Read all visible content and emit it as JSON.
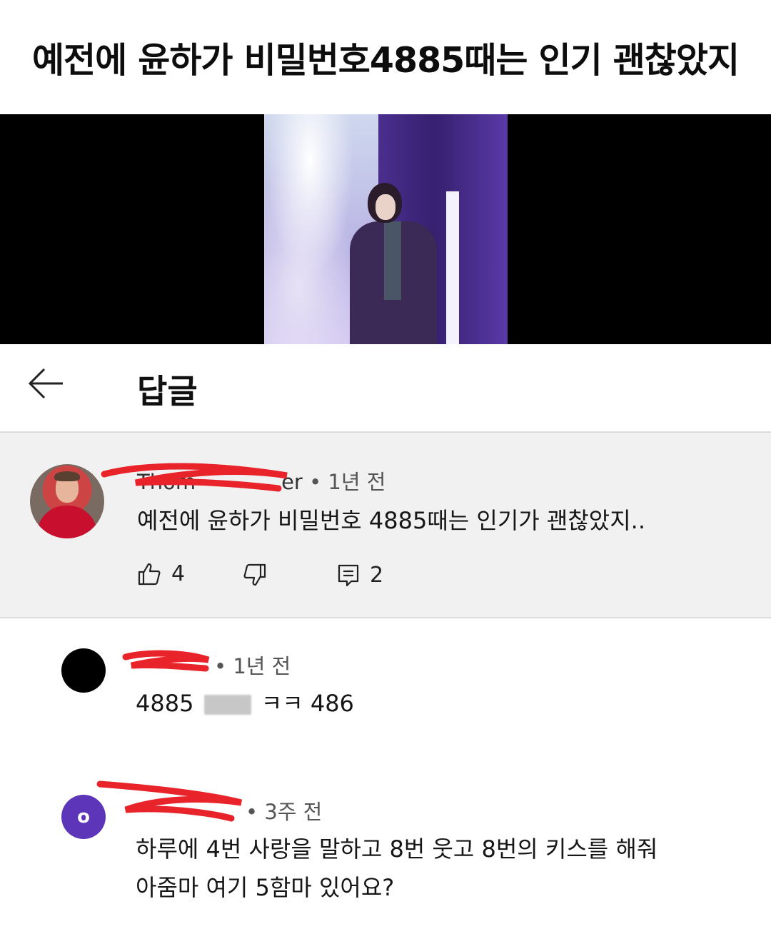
{
  "post": {
    "title": "예전에 윤하가 비밀번호4885때는 인기 괜찮았지"
  },
  "header": {
    "back_icon": "back-arrow-icon",
    "title": "답글"
  },
  "parent_comment": {
    "author_visible": "Thom",
    "author_tail": "er",
    "time": "• 1년 전",
    "text": "예전에 윤하가 비밀번호 4885때는 인기가 괜찮았지..",
    "like_count": "4",
    "reply_count": "2"
  },
  "replies": [
    {
      "time": "• 1년 전",
      "text_before": "4885",
      "text_after": "ㅋㅋ 486",
      "avatar_letter": ""
    },
    {
      "time": "• 3주 전",
      "line1": "하루에 4번 사랑을 말하고 8번 웃고 8번의 키스를 해줘",
      "line2": "아줌마 여기 5함마 있어요?",
      "avatar_letter": "o"
    }
  ],
  "colors": {
    "scribble": "#e8232a",
    "avatar_purple": "#5d35b8",
    "panel_bg": "#f1f1f1"
  }
}
